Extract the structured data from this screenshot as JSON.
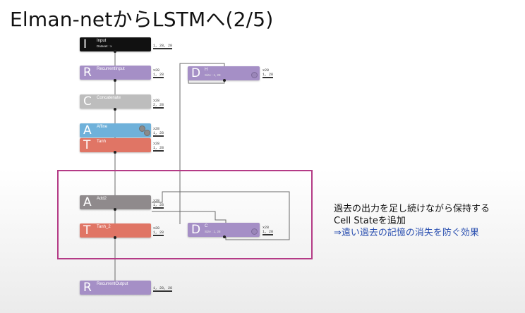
{
  "slide": {
    "title": "Elman-netからLSTMへ(2/5)"
  },
  "colors": {
    "input": "#111111",
    "recurrent": "#a58fc6",
    "delay": "#a58fc6",
    "concat": "#bdbdbd",
    "affine": "#6fb1da",
    "tanh": "#e07565",
    "add2": "#8f8a8c",
    "highlight": "#b43b86",
    "accent_text": "#2a4fb0"
  },
  "graph": {
    "nodes": [
      {
        "id": "input",
        "letter": "I",
        "name": "Input",
        "sub": "Dataset : x",
        "shape": "1, 28, 28"
      },
      {
        "id": "recurrent_input",
        "letter": "R",
        "name": "RecurrentInput",
        "sub": "",
        "shape": "x28\n1, 28"
      },
      {
        "id": "delay_h",
        "letter": "D",
        "name": "H",
        "sub": "Size : 1, 28",
        "shape": "x28\n1, 28"
      },
      {
        "id": "concatenate",
        "letter": "C",
        "name": "Concatenate",
        "sub": "",
        "shape": "x28\n2, 28"
      },
      {
        "id": "affine",
        "letter": "A",
        "name": "Affine",
        "sub": "",
        "shape": "x28\n1, 28"
      },
      {
        "id": "tanh",
        "letter": "T",
        "name": "Tanh",
        "sub": "",
        "shape": "x28\n1, 28"
      },
      {
        "id": "add2",
        "letter": "A",
        "name": "Add2",
        "sub": "",
        "shape": "x28\n1, 28"
      },
      {
        "id": "tanh_2",
        "letter": "T",
        "name": "Tanh_2",
        "sub": "",
        "shape": "x28\n1, 28"
      },
      {
        "id": "delay_c",
        "letter": "D",
        "name": "C",
        "sub": "Size : 1, 28",
        "shape": "x28\n1, 28"
      },
      {
        "id": "recurrent_output",
        "letter": "R",
        "name": "RecurrentOutput",
        "sub": "",
        "shape": "1, 28, 28"
      }
    ]
  },
  "note": {
    "line1": "過去の出力を足し続けながら保持する",
    "line2": "Cell Stateを追加",
    "line3": "⇒遠い過去の記憶の消失を防ぐ効果"
  }
}
